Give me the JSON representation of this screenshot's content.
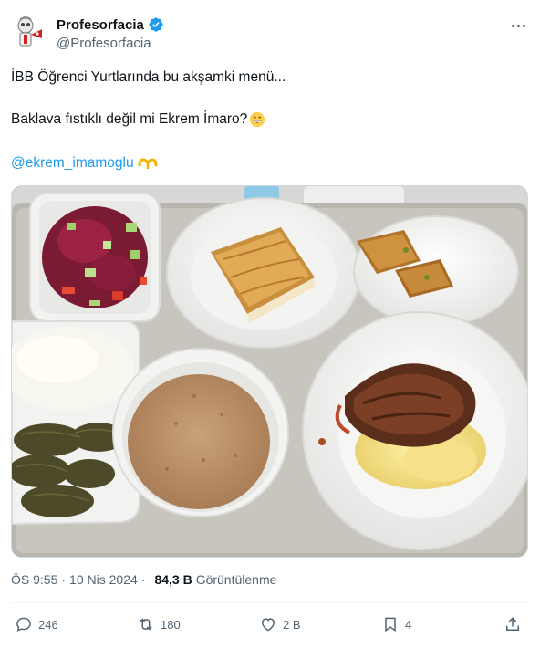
{
  "author": {
    "display_name": "Profesorfacia",
    "handle": "@Profesorfacia",
    "verified": true
  },
  "tweet": {
    "line1": "İBB Öğrenci Yurtlarında bu akşamki menü...",
    "line2": "Baklava fıstıklı değil mi Ekrem İmaro?",
    "mention": "@ekrem_imamoglu"
  },
  "meta": {
    "time": "ÖS 9:55",
    "separator": "·",
    "date": "10 Nis 2024",
    "views_count": "84,3 B",
    "views_label": "Görüntülenme"
  },
  "actions": {
    "replies": "246",
    "reposts": "180",
    "likes": "2 B",
    "bookmarks": "4"
  },
  "icons": [
    "verified-icon",
    "more-icon",
    "reply-icon",
    "repost-icon",
    "like-icon",
    "bookmark-icon",
    "share-icon"
  ],
  "colors": {
    "accent": "#1d9bf0",
    "text": "#0f1419",
    "secondary": "#536471"
  }
}
